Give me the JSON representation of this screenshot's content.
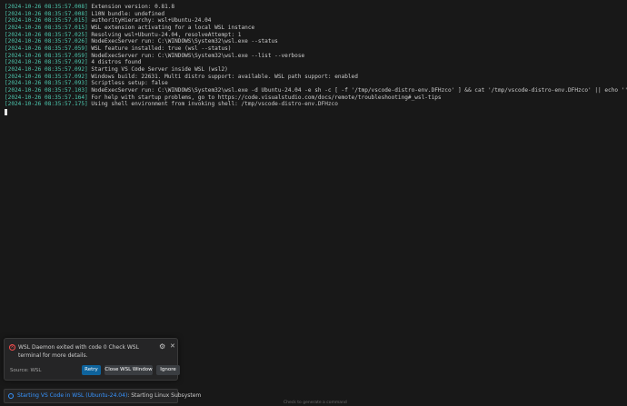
{
  "terminal": {
    "lines": [
      {
        "ts": "[2024-10-26 08:35:57.008]",
        "msg": " Extension version: 0.81.8"
      },
      {
        "ts": "[2024-10-26 08:35:57.008]",
        "msg": " L10N bundle: undefined"
      },
      {
        "ts": "[2024-10-26 08:35:57.015]",
        "msg": " authorityHierarchy: wsl+Ubuntu-24.04"
      },
      {
        "ts": "[2024-10-26 08:35:57.015]",
        "msg": " WSL extension activating for a local WSL instance"
      },
      {
        "ts": "[2024-10-26 08:35:57.025]",
        "msg": " Resolving wsl+Ubuntu-24.04, resolveAttempt: 1"
      },
      {
        "ts": "[2024-10-26 08:35:57.026]",
        "msg": " NodeExecServer run: C:\\WINDOWS\\System32\\wsl.exe --status"
      },
      {
        "ts": "[2024-10-26 08:35:57.059]",
        "msg": " WSL feature installed: true (wsl --status)"
      },
      {
        "ts": "[2024-10-26 08:35:57.059]",
        "msg": " NodeExecServer run: C:\\WINDOWS\\System32\\wsl.exe --list --verbose"
      },
      {
        "ts": "[2024-10-26 08:35:57.092]",
        "msg": " 4 distros found"
      },
      {
        "ts": "[2024-10-26 08:35:57.092]",
        "msg": " Starting VS Code Server inside WSL (wsl2)"
      },
      {
        "ts": "[2024-10-26 08:35:57.092]",
        "msg": " Windows build: 22631. Multi distro support: available. WSL path support: enabled"
      },
      {
        "ts": "[2024-10-26 08:35:57.093]",
        "msg": " Scriptless setup: false"
      },
      {
        "ts": "[2024-10-26 08:35:57.103]",
        "msg": " NodeExecServer run: C:\\WINDOWS\\System32\\wsl.exe -d Ubuntu-24.04 -e sh -c [ -f '/tmp/vscode-distro-env.DFHzco' ] && cat '/tmp/vscode-distro-env.DFHzco' || echo ''"
      },
      {
        "ts": "[2024-10-26 08:35:57.164]",
        "msg": " For help with startup problems, go to https://code.visualstudio.com/docs/remote/troubleshooting#_wsl-tips"
      },
      {
        "ts": "[2024-10-26 08:35:57.175]",
        "msg": " Using shell environment from invoking shell: /tmp/vscode-distro-env.DFHzco"
      }
    ]
  },
  "notification": {
    "icon": "error-icon",
    "message": "WSL Daemon exited with code 0 Check WSL terminal for more details.",
    "source": "Source: WSL",
    "buttons": {
      "retry": "Retry",
      "close_wsl": "Close WSL Window",
      "ignore": "Ignore"
    },
    "gear_icon": "gear-icon",
    "close_icon": "close-icon"
  },
  "progress": {
    "icon": "info-icon",
    "link": "Starting VS Code in WSL (Ubuntu-24.04)",
    "status": ": Starting Linux Subsystem"
  },
  "footer": {
    "hint": "Check to generate a command"
  }
}
